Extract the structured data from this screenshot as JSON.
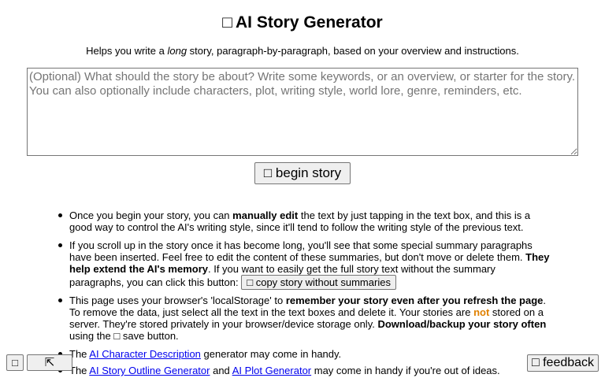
{
  "header": {
    "title_icon": "□",
    "title": "AI Story Generator",
    "subtitle_pre": "Helps you write a ",
    "subtitle_em": "long",
    "subtitle_post": " story, paragraph-by-paragraph, based on your overview and instructions."
  },
  "story_input": {
    "value": "",
    "placeholder": "(Optional) What should the story be about? Write some keywords, or an overview, or starter for the story. You can also optionally include characters, plot, writing style, world lore, genre, reminders, etc."
  },
  "begin_button": {
    "icon": "□",
    "label": "begin story"
  },
  "info": {
    "item1": {
      "t1": "Once you begin your story, you can ",
      "b1": "manually edit",
      "t2": " the text by just tapping in the text box, and this is a good way to control the AI's writing style, since it'll tend to follow the writing style of the previous text."
    },
    "item2": {
      "t1": "If you scroll up in the story once it has become long, you'll see that some special summary paragraphs have been inserted. Feel free to edit the content of these summaries, but don't move or delete them. ",
      "b1": "They help extend the AI's memory",
      "t2": ". If you want to easily get the full story text without the summary paragraphs, you can click this button: ",
      "button_icon": "□",
      "button_label": "copy story without summaries"
    },
    "item3": {
      "t1": "This page uses your browser's 'localStorage' to ",
      "b1": "remember your story even after you refresh the page",
      "t2": ". To remove the data, just select all the text in the text boxes and delete it. Your stories are ",
      "not": "not",
      "t3": " stored on a server. They're stored privately in your browser/device storage only. ",
      "b2": "Download/backup your story often",
      "t4": " using the ",
      "save_icon": "□",
      "t5": " save button."
    },
    "item4": {
      "t1": "The ",
      "link": "AI Character Description",
      "t2": " generator may come in handy."
    },
    "item5": {
      "t1": "The ",
      "link1": "AI Story Outline Generator",
      "t2": " and ",
      "link2": "AI Plot Generator",
      "t3": " may come in handy if you're out of ideas."
    }
  },
  "footer": {
    "save_icon": "□",
    "scroll_top_icon": "⇱",
    "feedback_icon": "□",
    "feedback_label": "feedback"
  },
  "colors": {
    "not_highlight": "#e08000",
    "link": "#0000ee"
  }
}
